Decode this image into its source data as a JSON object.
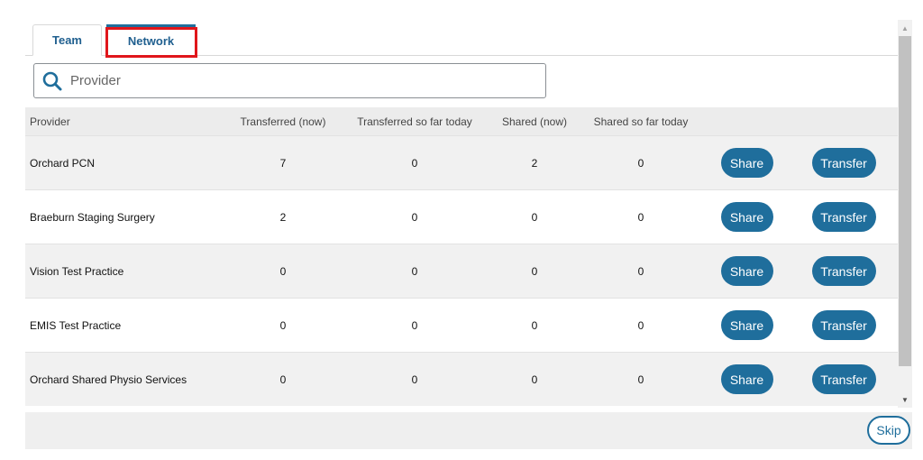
{
  "tabs": [
    {
      "label": "Team"
    },
    {
      "label": "Network"
    }
  ],
  "search": {
    "placeholder": "Provider",
    "value": "",
    "icon": "search-icon"
  },
  "table": {
    "headers": [
      "Provider",
      "Transferred (now)",
      "Transferred so far today",
      "Shared (now)",
      "Shared so far today"
    ],
    "rows": [
      {
        "provider": "Orchard PCN",
        "transferred_now": "7",
        "transferred_today": "0",
        "shared_now": "2",
        "shared_today": "0",
        "share_label": "Share",
        "transfer_label": "Transfer"
      },
      {
        "provider": "Braeburn Staging Surgery",
        "transferred_now": "2",
        "transferred_today": "0",
        "shared_now": "0",
        "shared_today": "0",
        "share_label": "Share",
        "transfer_label": "Transfer"
      },
      {
        "provider": "Vision Test Practice",
        "transferred_now": "0",
        "transferred_today": "0",
        "shared_now": "0",
        "shared_today": "0",
        "share_label": "Share",
        "transfer_label": "Transfer"
      },
      {
        "provider": "EMIS Test Practice",
        "transferred_now": "0",
        "transferred_today": "0",
        "shared_now": "0",
        "shared_today": "0",
        "share_label": "Share",
        "transfer_label": "Transfer"
      },
      {
        "provider": "Orchard Shared Physio Services",
        "transferred_now": "0",
        "transferred_today": "0",
        "shared_now": "0",
        "shared_today": "0",
        "share_label": "Share",
        "transfer_label": "Transfer"
      }
    ]
  },
  "footer": {
    "skip_label": "Skip"
  },
  "colors": {
    "accent": "#1f6e9c",
    "highlight": "#e0161b",
    "row_alt": "#f1f1f1"
  }
}
